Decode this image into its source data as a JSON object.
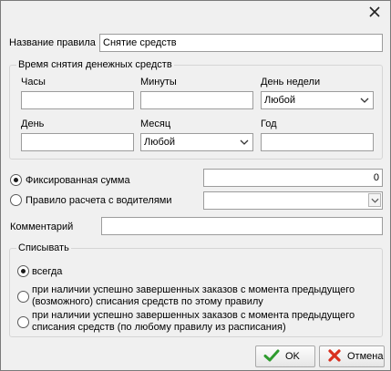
{
  "dialog": {
    "close_glyph": "✕"
  },
  "rule_name": {
    "label": "Название правила",
    "value": "Снятие средств"
  },
  "withdraw_time": {
    "group_title": "Время снятия денежных средств",
    "hours_label": "Часы",
    "hours_value": "",
    "minutes_label": "Минуты",
    "minutes_value": "",
    "weekday_label": "День недели",
    "weekday_selected": "Любой",
    "day_label": "День",
    "day_value": "",
    "month_label": "Месяц",
    "month_selected": "Любой",
    "year_label": "Год",
    "year_value": ""
  },
  "amount_mode": {
    "fixed_label": "Фиксированная сумма",
    "fixed_selected": true,
    "fixed_value": "0",
    "driver_rule_label": "Правило расчета с водителями",
    "driver_rule_selected": false,
    "driver_rule_value": ""
  },
  "comment": {
    "label": "Комментарий",
    "value": ""
  },
  "debit": {
    "group_title": "Списывать",
    "always_label": "всегда",
    "option1_label": "при наличии успешно завершенных заказов с момента предыдущего (возможного) списания средств по этому правилу",
    "option2_label": "при наличии успешно завершенных заказов с момента предыдущего списания средств (по любому правилу из расписания)",
    "selected": "always"
  },
  "buttons": {
    "ok_label": "OK",
    "cancel_label": "Отмена"
  },
  "colors": {
    "ok_icon": "#2e9b2e",
    "cancel_icon": "#d9301f"
  }
}
